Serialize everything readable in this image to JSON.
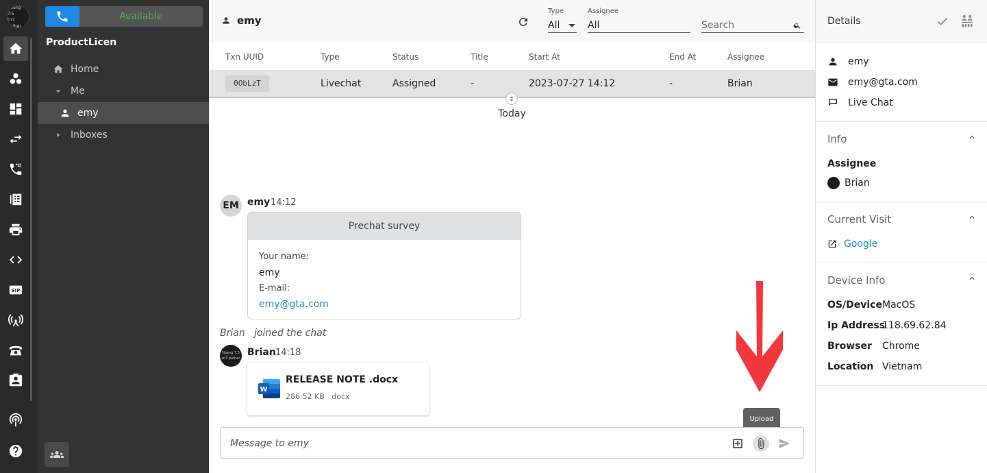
{
  "rail": {
    "avatar": {
      "line1": "Hoang 7:5",
      "line2": "tri7 pather"
    }
  },
  "nav": {
    "status": "Available",
    "workspace": "ProductLicen",
    "items": [
      {
        "label": "Home"
      },
      {
        "label": "Me"
      },
      {
        "label": "emy"
      },
      {
        "label": "Inboxes"
      }
    ]
  },
  "topbar": {
    "contact_name": "emy",
    "type_label": "Type",
    "type_value": "All",
    "assignee_label": "Assignee",
    "assignee_value": "All",
    "search_placeholder": "Search"
  },
  "table": {
    "headers": [
      "Txn UUID",
      "Type",
      "Status",
      "Title",
      "Start At",
      "End At",
      "Assignee"
    ],
    "row": {
      "uuid": "0ObLzT",
      "type": "Livechat",
      "status": "Assigned",
      "title": "-",
      "start": "2023-07-27 14:12",
      "end": "-",
      "assignee": "Brian"
    }
  },
  "chat": {
    "day": "Today",
    "msg1": {
      "avatar": "EM",
      "name": "emy",
      "time": "14:12"
    },
    "survey": {
      "title": "Prechat survey",
      "name_label": "Your name:",
      "name_value": "emy",
      "email_label": "E-mail:",
      "email_value": "emy@gta.com"
    },
    "joined": {
      "who": "Brian",
      "text": "joined the chat"
    },
    "msg2": {
      "name": "Brian",
      "time": "14:18",
      "avatar_line1": "Hoang 7:5",
      "avatar_line2": "tri7 pather"
    },
    "file": {
      "name": "RELEASE NOTE .docx",
      "size": "286.52 KB",
      "ext": "docx"
    },
    "tooltip": "Upload",
    "composer_placeholder": "Message to emy"
  },
  "details": {
    "title": "Details",
    "name": "emy",
    "email": "emy@gta.com",
    "channel": "Live Chat",
    "info_title": "Info",
    "assignee_label": "Assignee",
    "assignee_value": "Brian",
    "visit_title": "Current Visit",
    "visit_link": "Google",
    "device_title": "Device Info",
    "device": [
      {
        "key": "OS/Device",
        "value": "MacOS"
      },
      {
        "key": "Ip Address",
        "value": "118.69.62.84"
      },
      {
        "key": "Browser",
        "value": "Chrome"
      },
      {
        "key": "Location",
        "value": "Vietnam"
      }
    ]
  },
  "colors": {
    "accent": "#1e88e5",
    "available": "#4caf50",
    "link": "#1e88c8",
    "arrow": "#f2373c"
  }
}
